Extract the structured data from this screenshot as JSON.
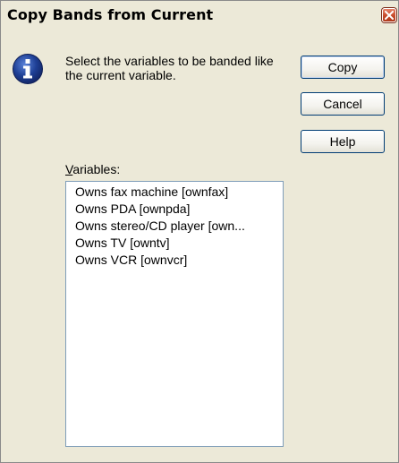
{
  "window": {
    "title": "Copy Bands from Current",
    "close_icon": "close-icon"
  },
  "message": {
    "icon": "info-icon",
    "text": "Select the variables to be banded like the current variable."
  },
  "buttons": {
    "copy_label": "Copy",
    "cancel_label": "Cancel",
    "help_label": "Help"
  },
  "variables": {
    "label_mnemonic": "V",
    "label_rest": "ariables:",
    "items": [
      "Owns fax machine [ownfax]",
      "Owns PDA [ownpda]",
      "Owns stereo/CD player [own...",
      "Owns TV [owntv]",
      "Owns VCR [ownvcr]"
    ]
  },
  "colors": {
    "dialog_bg": "#ece9d8",
    "close_button": "#c64a2a",
    "info_icon": "#1e3f95",
    "button_border": "#003c74",
    "listbox_border": "#7f9db9"
  }
}
